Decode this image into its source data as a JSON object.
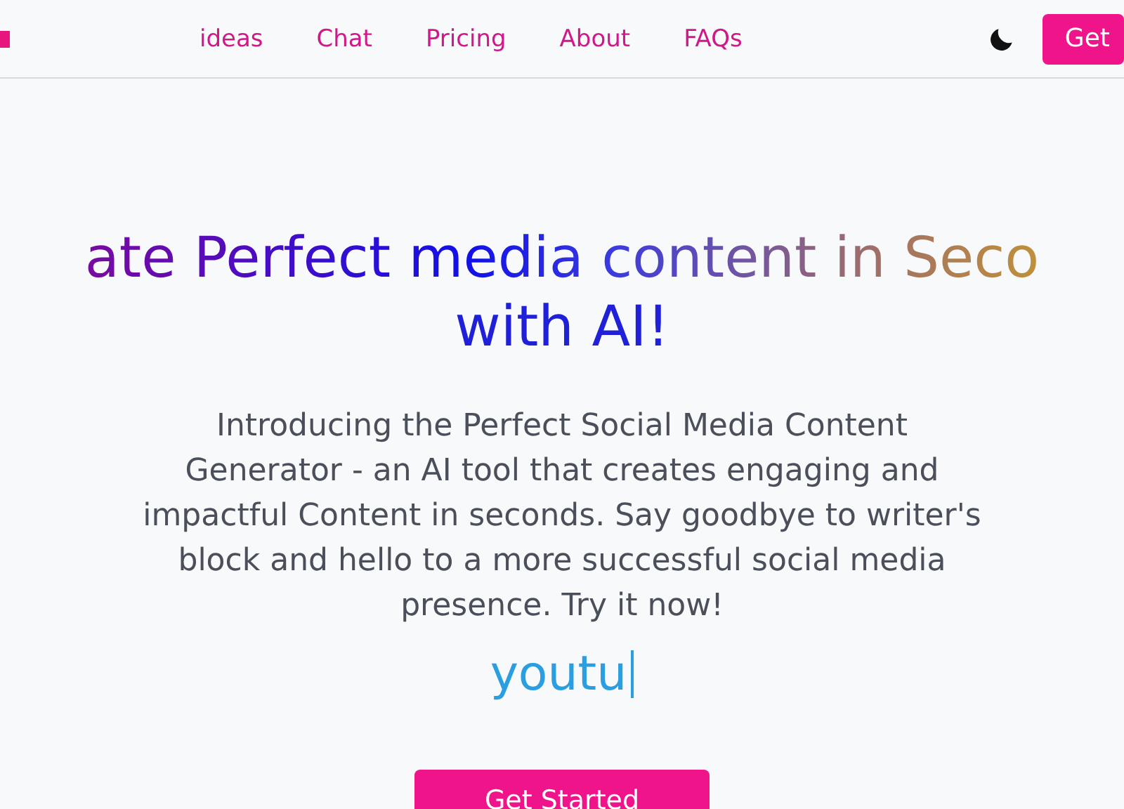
{
  "nav": {
    "links": [
      {
        "label": "ideas"
      },
      {
        "label": "Chat"
      },
      {
        "label": "Pricing"
      },
      {
        "label": "About"
      },
      {
        "label": "FAQs"
      }
    ],
    "cta": "Get"
  },
  "hero": {
    "title_lines": [
      "ate Perfect media content in Seco",
      "with AI!"
    ],
    "description": "Introducing the Perfect Social Media Content Generator - an AI tool that creates engaging and impactful Content in seconds. Say goodbye to writer's block and hello to a more successful social media presence. Try it now!",
    "typed_text": "youtu",
    "button": "Get Started"
  }
}
